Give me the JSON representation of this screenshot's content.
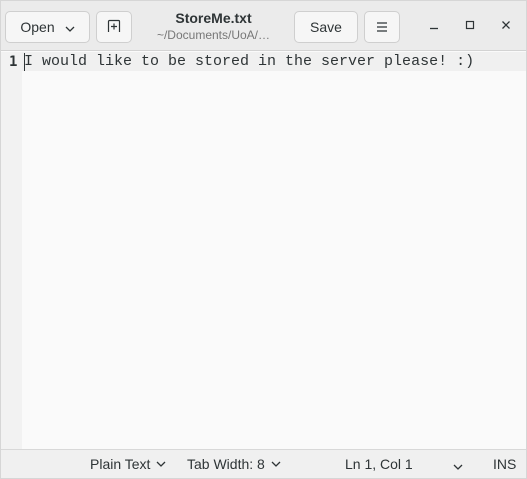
{
  "header": {
    "open_label": "Open",
    "title": "StoreMe.txt",
    "subtitle": "~/Documents/UoA/…",
    "save_label": "Save"
  },
  "editor": {
    "lines": [
      {
        "number": "1",
        "text": "I would like to be stored in the server please! :)"
      }
    ]
  },
  "statusbar": {
    "language": "Plain Text",
    "tab_width": "Tab Width: 8",
    "position": "Ln 1, Col 1",
    "mode": "INS"
  },
  "icons": {
    "open_dropdown": "chevron-down-icon",
    "new_tab": "new-tab-icon",
    "menu": "hamburger-menu-icon",
    "minimize": "minimize-icon",
    "maximize": "maximize-icon",
    "close": "close-icon"
  }
}
